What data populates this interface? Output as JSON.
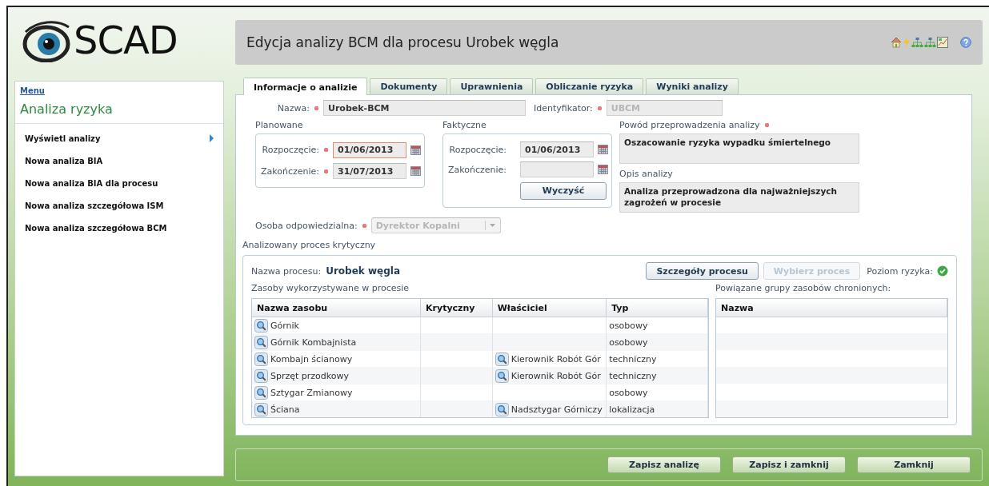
{
  "logo": {
    "text": "SCAD"
  },
  "title": "Edycja analizy BCM dla procesu Urobek węgla",
  "sidebar": {
    "menu_link": "Menu",
    "heading": "Analiza ryzyka",
    "items": [
      {
        "label": "Wyświetl analizy",
        "selected": true
      },
      {
        "label": "Nowa analiza BIA",
        "selected": false
      },
      {
        "label": "Nowa analiza BIA dla procesu",
        "selected": false
      },
      {
        "label": "Nowa analiza szczegółowa ISM",
        "selected": false
      },
      {
        "label": "Nowa analiza szczegółowa BCM",
        "selected": false
      }
    ]
  },
  "tabs": [
    {
      "label": "Informacje o analizie",
      "selected": true
    },
    {
      "label": "Dokumenty",
      "selected": false
    },
    {
      "label": "Uprawnienia",
      "selected": false
    },
    {
      "label": "Obliczanie ryzyka",
      "selected": false
    },
    {
      "label": "Wyniki analizy",
      "selected": false
    }
  ],
  "form": {
    "name": {
      "label": "Nazwa:",
      "value": "Urobek-BCM",
      "required": true,
      "disabled": false
    },
    "identifier": {
      "label": "Identyfikator:",
      "value": "UBCM",
      "required": true,
      "disabled": true
    },
    "planned": {
      "legend": "Planowane",
      "start": {
        "label": "Rozpoczęcie:",
        "value": "01/06/2013",
        "required": true,
        "focused": true
      },
      "end": {
        "label": "Zakończenie:",
        "value": "31/07/2013",
        "required": true,
        "focused": false
      }
    },
    "actual": {
      "legend": "Faktyczne",
      "start": {
        "label": "Rozpoczęcie:",
        "value": "01/06/2013",
        "required": false,
        "focused": false
      },
      "end": {
        "label": "Zakończenie:",
        "required": false,
        "focused": false
      },
      "clear_button": "Wyczyść"
    },
    "reason": {
      "label": "Powód przeprowadzenia analizy",
      "required": true,
      "value": "Oszacowanie ryzyka wypadku śmiertelnego"
    },
    "description": {
      "label": "Opis analizy",
      "required": false,
      "value": "Analiza przeprowadzona dla najważniejszych zagrożeń w procesie"
    },
    "responsible": {
      "label": "Osoba odpowiedzialna:",
      "required": true,
      "value": "Dyrektor Kopalni",
      "disabled": true
    }
  },
  "process": {
    "heading": "Analizowany proces krytyczny",
    "name_label": "Nazwa procesu:",
    "name": "Urobek węgla",
    "details_button": {
      "label": "Szczegóły procesu",
      "disabled": false
    },
    "select_button": {
      "label": "Wybierz proces",
      "disabled": true
    },
    "risk_label": "Poziom ryzyka:",
    "resources": {
      "heading": "Zasoby wykorzystywane w procesie",
      "columns": [
        "Nazwa zasobu",
        "Krytyczny",
        "Właściciel",
        "Typ"
      ],
      "rows": [
        {
          "name": "Górnik",
          "type": "osobowy"
        },
        {
          "name": "Górnik Kombajnista",
          "type": "osobowy"
        },
        {
          "name": "Kombajn ścianowy",
          "owner": "Kierownik Robót Gór",
          "type": "techniczny"
        },
        {
          "name": "Sprzęt przodkowy",
          "owner": "Kierownik Robót Gór",
          "type": "techniczny"
        },
        {
          "name": "Sztygar Zmianowy",
          "type": "osobowy"
        },
        {
          "name": "Ściana",
          "owner": "Nadsztygar Górniczy",
          "type": "lokalizacja"
        }
      ]
    },
    "groups": {
      "heading": "Powiązane grupy zasobów chronionych:",
      "columns": [
        "Nazwa"
      ]
    }
  },
  "footer_buttons": [
    "Zapisz analizę",
    "Zapisz i zamknij",
    "Zamknij"
  ]
}
